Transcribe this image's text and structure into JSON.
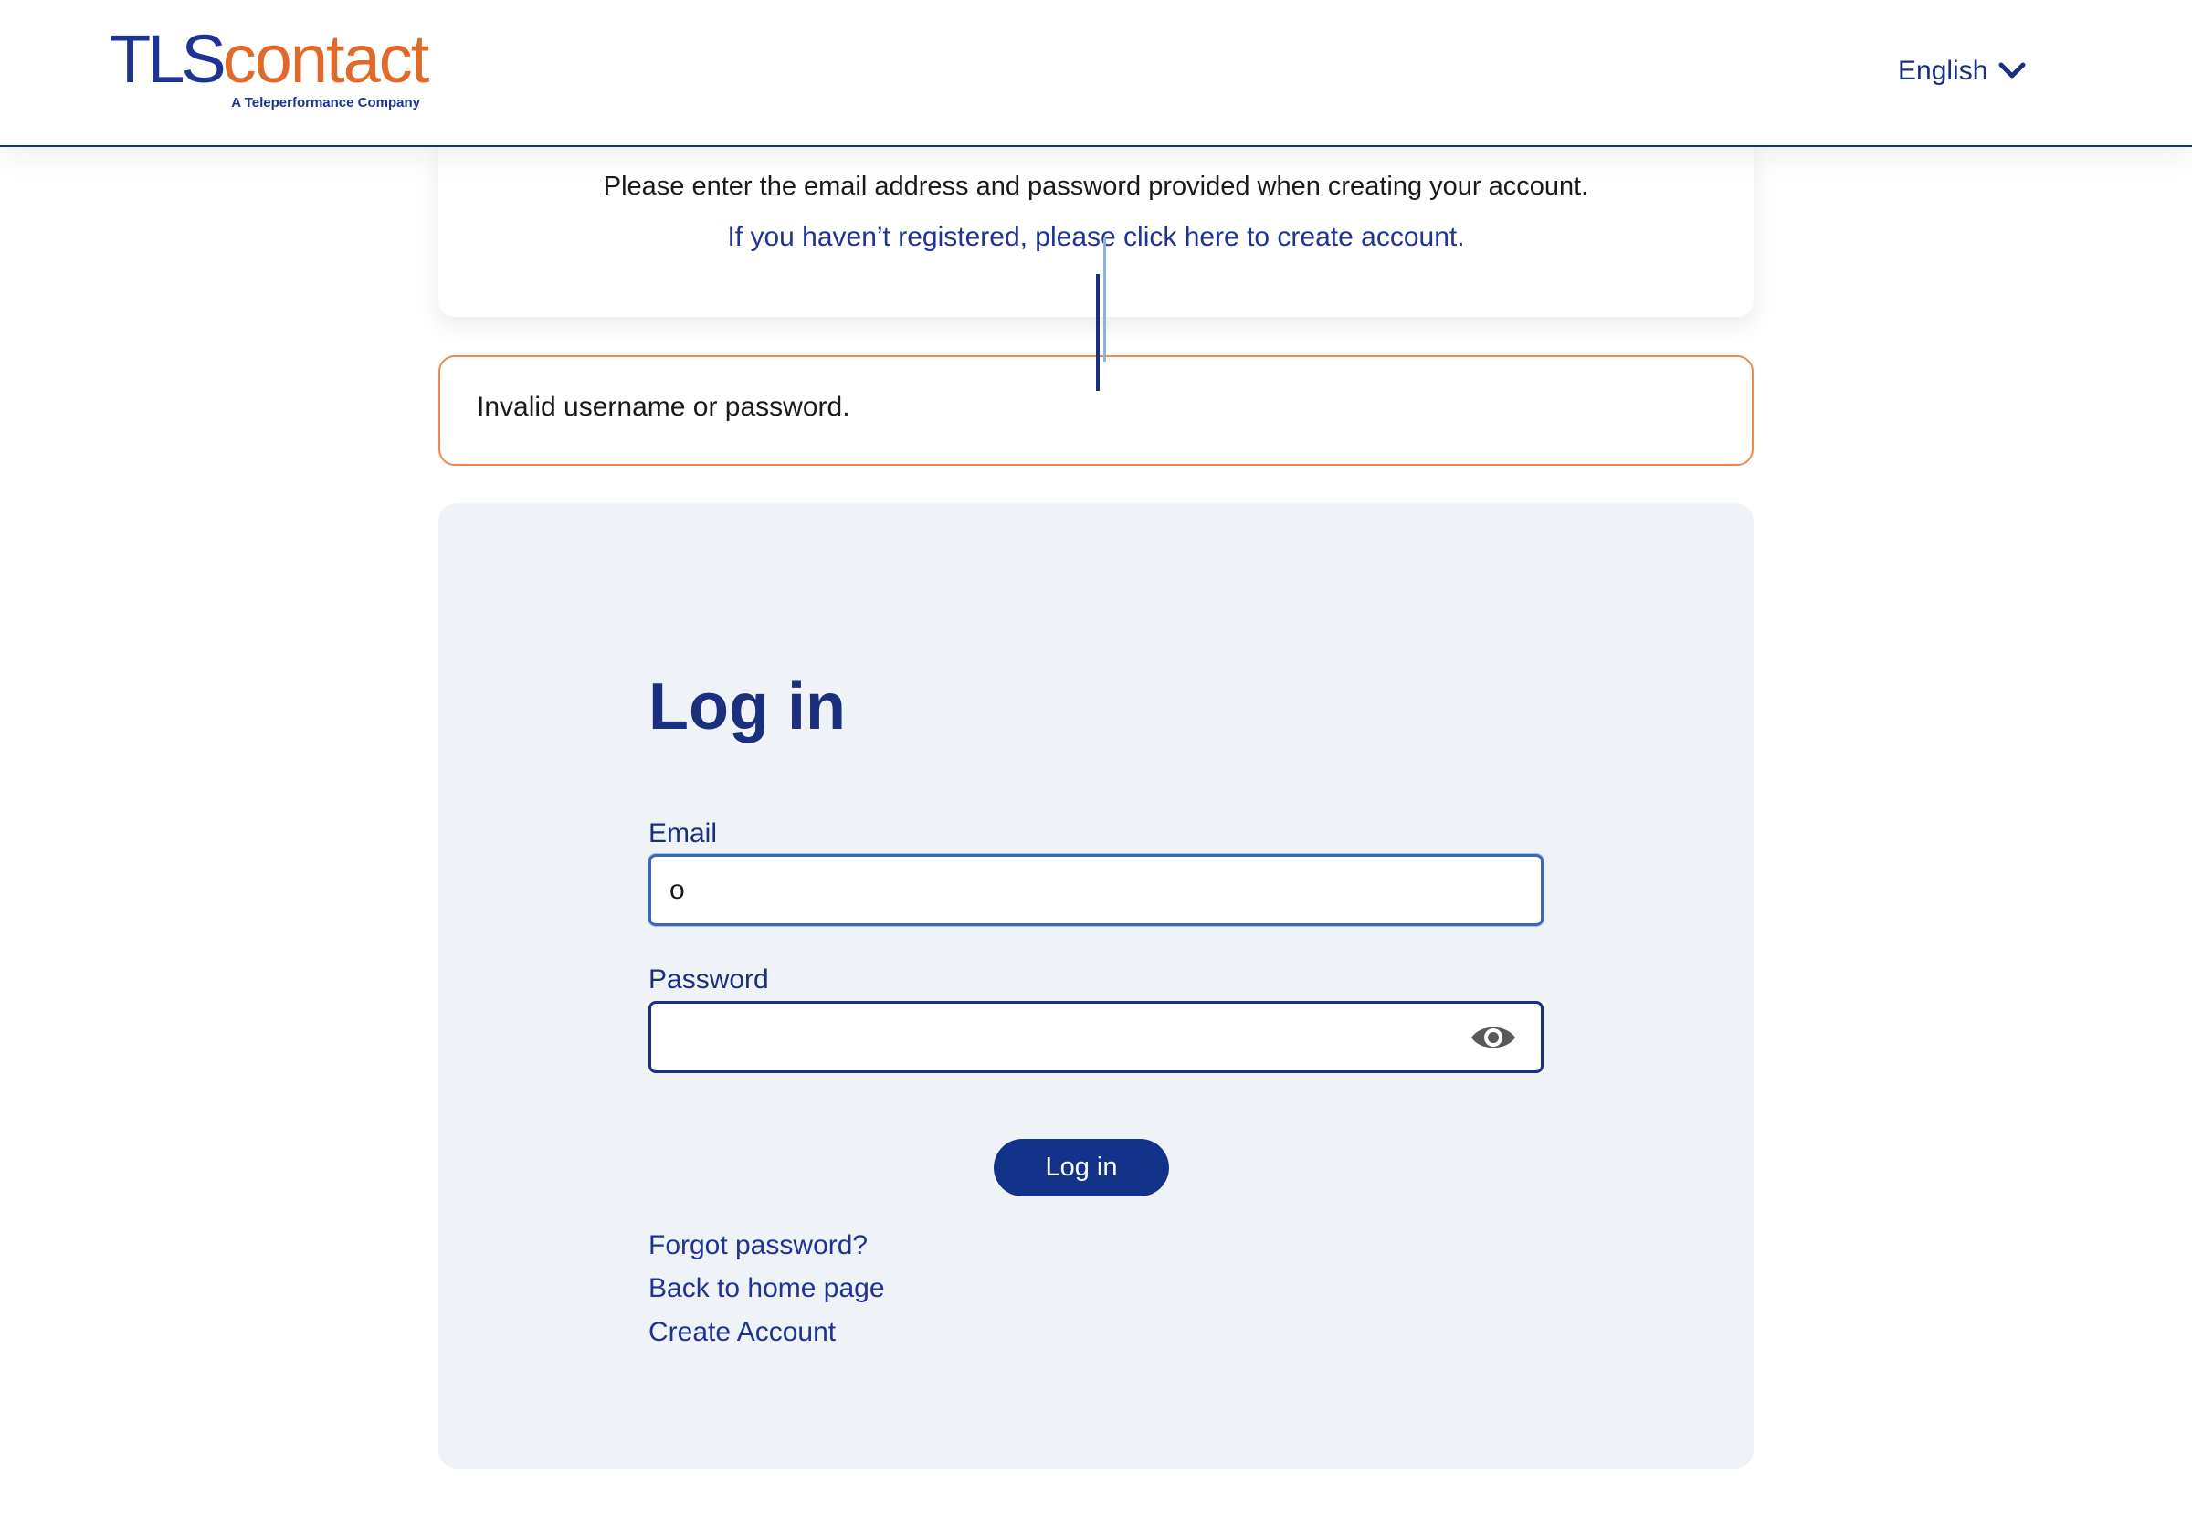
{
  "header": {
    "logo_tls": "TLS",
    "logo_contact": "contact",
    "logo_tagline": "A Teleperformance Company",
    "language": "English",
    "language_icon": "chevron-down-icon"
  },
  "info": {
    "instruction": "Please enter the email address and password provided when creating your account.",
    "register_link": "If you haven’t registered, please click here to create account."
  },
  "alert": {
    "message": "Invalid username or password."
  },
  "login": {
    "title": "Log in",
    "email_label": "Email",
    "email_value": "o",
    "password_label": "Password",
    "password_value": "",
    "password_toggle_icon": "eye-icon",
    "submit_label": "Log in",
    "forgot_password": "Forgot password?",
    "back_home": "Back to home page",
    "create_account": "Create Account"
  },
  "colors": {
    "brand_blue": "#1a2f7d",
    "brand_orange": "#e06a2a",
    "alert_border": "#ee8a45",
    "panel_bg": "#eff3f7",
    "button_bg": "#13338a"
  }
}
